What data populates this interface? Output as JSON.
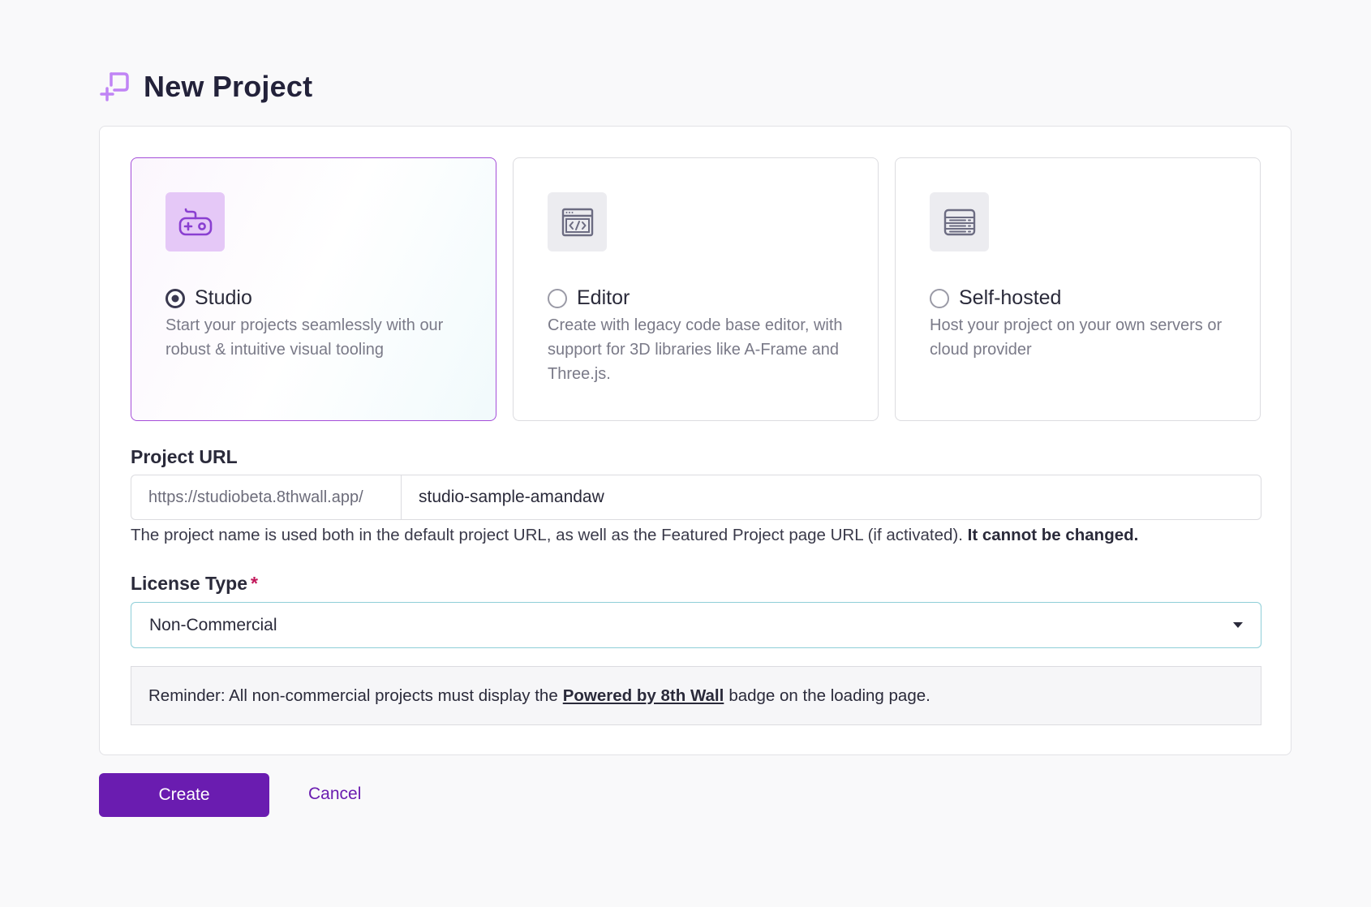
{
  "header": {
    "title": "New Project",
    "icon": "new-project-icon",
    "accent": "#c084f5"
  },
  "project_types": [
    {
      "key": "studio",
      "title": "Studio",
      "description": "Start your projects seamlessly with our robust & intuitive visual tooling",
      "icon": "gamepad-icon",
      "selected": true
    },
    {
      "key": "editor",
      "title": "Editor",
      "description": "Create with legacy code base editor, with support for 3D libraries like A-Frame and Three.js.",
      "icon": "code-window-icon",
      "selected": false
    },
    {
      "key": "self-hosted",
      "title": "Self-hosted",
      "description": "Host your project on your own servers or cloud provider",
      "icon": "server-icon",
      "selected": false
    }
  ],
  "project_url": {
    "label": "Project URL",
    "prefix": "https://studiobeta.8thwall.app/",
    "value": "studio-sample-amandaw",
    "hint_text": "The project name is used both in the default project URL, as well as the Featured Project page URL (if activated).",
    "hint_bold": "It cannot be changed."
  },
  "license": {
    "label": "License Type",
    "required_mark": "*",
    "selected": "Non-Commercial"
  },
  "reminder": {
    "before": "Reminder: All non-commercial projects must display the",
    "link": "Powered by 8th Wall",
    "after": "badge on the loading page."
  },
  "actions": {
    "create_label": "Create",
    "cancel_label": "Cancel"
  },
  "colors": {
    "primary": "#6a1cb0",
    "selected_border": "#a54ed9",
    "required": "#c2185b"
  }
}
